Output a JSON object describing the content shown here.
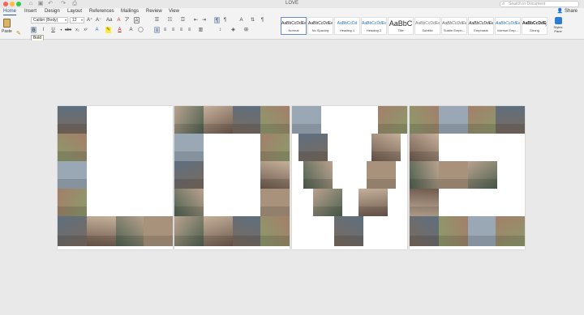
{
  "window": {
    "title": "LOVE",
    "search_placeholder": "Search in Document"
  },
  "ribbon": {
    "tabs": [
      "Home",
      "Insert",
      "Design",
      "Layout",
      "References",
      "Mailings",
      "Review",
      "View"
    ],
    "active_tab": "Home",
    "share_label": "Share",
    "paste_label": "Paste",
    "font_name": "Calibri (Body)",
    "font_size": "12",
    "tooltip": "Bold",
    "styles": [
      {
        "sample": "AaBbCcDdEe",
        "name": "Normal"
      },
      {
        "sample": "AaBbCcDdEe",
        "name": "No Spacing"
      },
      {
        "sample": "AaBbCcDd",
        "name": "Heading 1"
      },
      {
        "sample": "AaBbCcDdEe",
        "name": "Heading 2"
      },
      {
        "sample": "AaBbC",
        "name": "Title"
      },
      {
        "sample": "AaBbCcDdEe",
        "name": "Subtitle"
      },
      {
        "sample": "AaBbCcDdEe",
        "name": "Subtle Emph..."
      },
      {
        "sample": "AaBbCcDdEe",
        "name": "Emphasis"
      },
      {
        "sample": "AaBbCcDdEe",
        "name": "Intense Emp..."
      },
      {
        "sample": "AaBbCcDdEe",
        "name": "Strong"
      }
    ],
    "styles_pane_label": "Styles Pane"
  },
  "colors": {
    "accent": "#2b579a",
    "photo_palette": [
      "#7b6a5d",
      "#a8927c",
      "#5d6f80",
      "#8c9a6b",
      "#b8a28e",
      "#6f5a4e",
      "#9aa7b5",
      "#c4b09a",
      "#4e6150",
      "#a37f6a"
    ]
  }
}
